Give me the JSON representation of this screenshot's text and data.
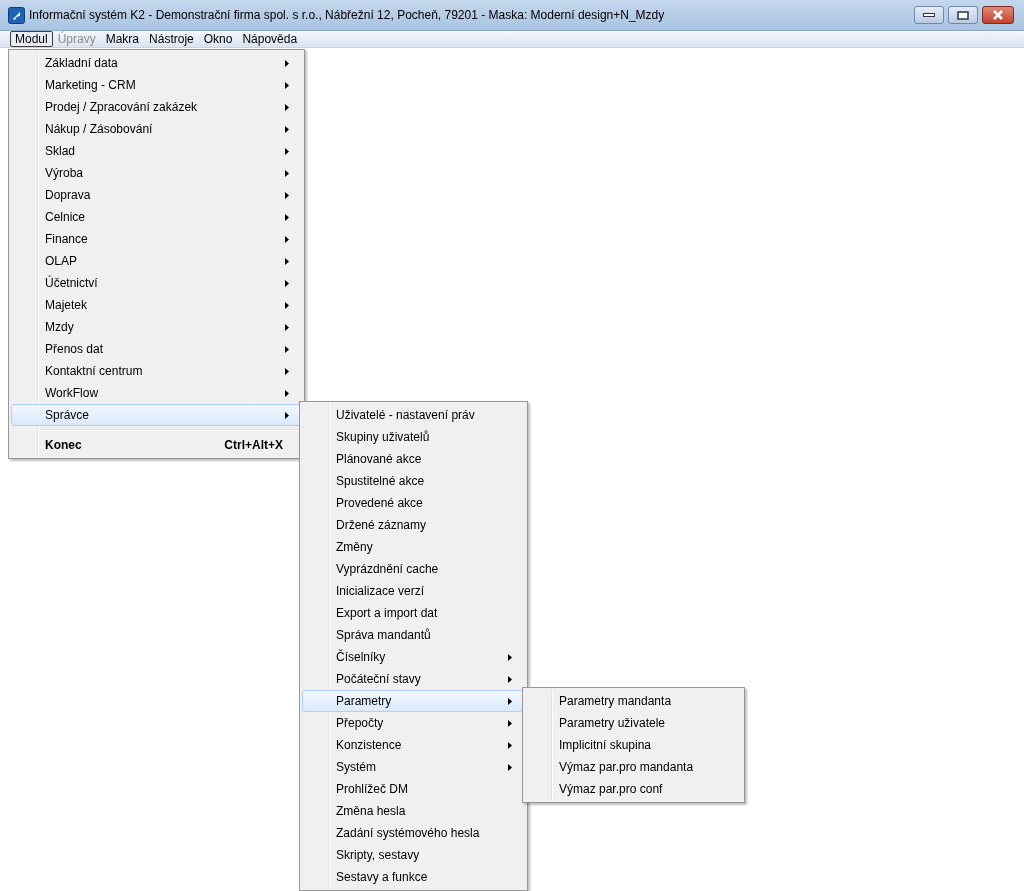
{
  "window": {
    "title": "Informační systém K2 - Demonstrační firma spol. s r.o., Nábřežní 12, Pocheň, 79201 -  Maska: Moderní design+N_Mzdy"
  },
  "menu_bar": [
    {
      "label": "Modul",
      "selected": true,
      "disabled": false
    },
    {
      "label": "Úpravy",
      "selected": false,
      "disabled": true
    },
    {
      "label": "Makra",
      "selected": false,
      "disabled": false
    },
    {
      "label": "Nástroje",
      "selected": false,
      "disabled": false
    },
    {
      "label": "Okno",
      "selected": false,
      "disabled": false
    },
    {
      "label": "Nápověda",
      "selected": false,
      "disabled": false
    }
  ],
  "menus": [
    {
      "items": [
        {
          "kind": "submenu",
          "label": "Základní data",
          "selected": false
        },
        {
          "kind": "submenu",
          "label": "Marketing - CRM",
          "selected": false
        },
        {
          "kind": "submenu",
          "label": "Prodej / Zpracování zakázek",
          "selected": false
        },
        {
          "kind": "submenu",
          "label": "Nákup / Zásobování",
          "selected": false
        },
        {
          "kind": "submenu",
          "label": "Sklad",
          "selected": false
        },
        {
          "kind": "submenu",
          "label": "Výroba",
          "selected": false
        },
        {
          "kind": "submenu",
          "label": "Doprava",
          "selected": false
        },
        {
          "kind": "submenu",
          "label": "Celnice",
          "selected": false
        },
        {
          "kind": "submenu",
          "label": "Finance",
          "selected": false
        },
        {
          "kind": "submenu",
          "label": "OLAP",
          "selected": false
        },
        {
          "kind": "submenu",
          "label": "Účetnictví",
          "selected": false
        },
        {
          "kind": "submenu",
          "label": "Majetek",
          "selected": false
        },
        {
          "kind": "submenu",
          "label": "Mzdy",
          "selected": false
        },
        {
          "kind": "submenu",
          "label": "Přenos dat",
          "selected": false
        },
        {
          "kind": "submenu",
          "label": "Kontaktní centrum",
          "selected": false
        },
        {
          "kind": "submenu",
          "label": "WorkFlow",
          "selected": false
        },
        {
          "kind": "submenu",
          "label": "Správce",
          "selected": true
        },
        {
          "kind": "separator"
        },
        {
          "kind": "default",
          "label": "Konec",
          "shortcut": "Ctrl+Alt+X",
          "selected": false
        }
      ]
    },
    {
      "items": [
        {
          "kind": "command",
          "label": "Uživatelé - nastavení práv",
          "selected": false
        },
        {
          "kind": "command",
          "label": "Skupiny uživatelů",
          "selected": false
        },
        {
          "kind": "command",
          "label": "Plánované akce",
          "selected": false
        },
        {
          "kind": "command",
          "label": "Spustitelné akce",
          "selected": false
        },
        {
          "kind": "command",
          "label": "Provedené akce",
          "selected": false
        },
        {
          "kind": "command",
          "label": "Držené záznamy",
          "selected": false
        },
        {
          "kind": "command",
          "label": "Změny",
          "selected": false
        },
        {
          "kind": "command",
          "label": "Vyprázdnění cache",
          "selected": false
        },
        {
          "kind": "command",
          "label": "Inicializace verzí",
          "selected": false
        },
        {
          "kind": "command",
          "label": "Export a import dat",
          "selected": false
        },
        {
          "kind": "command",
          "label": "Správa mandantů",
          "selected": false
        },
        {
          "kind": "submenu",
          "label": "Číselníky",
          "selected": false
        },
        {
          "kind": "submenu",
          "label": "Počáteční stavy",
          "selected": false
        },
        {
          "kind": "submenu",
          "label": "Parametry",
          "selected": true
        },
        {
          "kind": "submenu",
          "label": "Přepočty",
          "selected": false
        },
        {
          "kind": "submenu",
          "label": "Konzistence",
          "selected": false
        },
        {
          "kind": "submenu",
          "label": "Systém",
          "selected": false
        },
        {
          "kind": "command",
          "label": "Prohlížeč DM",
          "selected": false
        },
        {
          "kind": "command",
          "label": "Změna hesla",
          "selected": false
        },
        {
          "kind": "command",
          "label": "Zadání systémového hesla",
          "selected": false
        },
        {
          "kind": "command",
          "label": "Skripty, sestavy",
          "selected": false
        },
        {
          "kind": "command",
          "label": "Sestavy a funkce",
          "selected": false
        }
      ]
    },
    {
      "items": [
        {
          "kind": "command",
          "label": "Parametry mandanta",
          "selected": false
        },
        {
          "kind": "command",
          "label": "Parametry uživatele",
          "selected": false
        },
        {
          "kind": "command",
          "label": "Implicitní skupina",
          "selected": false
        },
        {
          "kind": "command",
          "label": "Výmaz par.pro mandanta",
          "selected": false
        },
        {
          "kind": "command",
          "label": "Výmaz par.pro conf",
          "selected": false
        }
      ]
    }
  ]
}
